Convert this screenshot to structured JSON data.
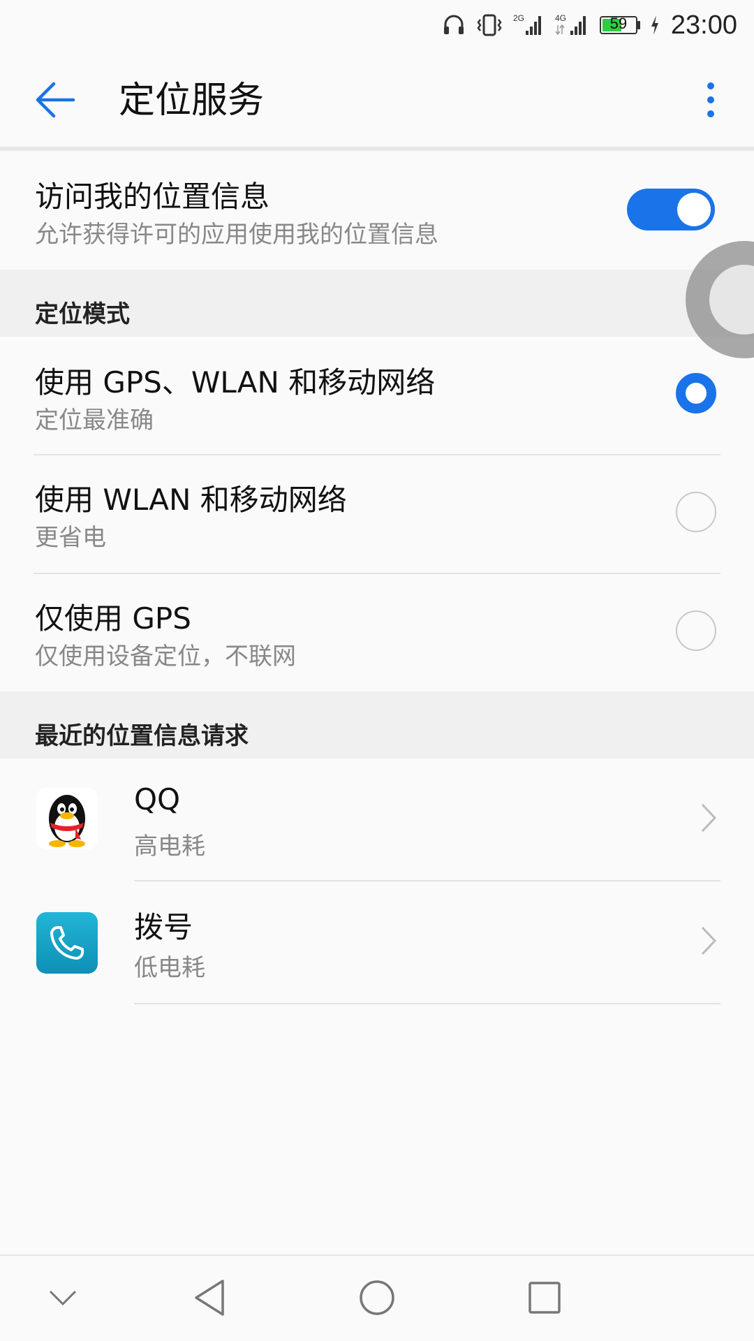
{
  "status_bar": {
    "time": "23:00",
    "battery_level": "59",
    "icons": [
      "headset-icon",
      "vibrate-icon",
      "signal-2g-icon",
      "signal-4g-icon",
      "battery-icon",
      "charging-icon"
    ],
    "network_1": "2G",
    "network_2": "4G"
  },
  "app_bar": {
    "title": "定位服务"
  },
  "location_access": {
    "title": "访问我的位置信息",
    "subtitle": "允许获得许可的应用使用我的位置信息",
    "enabled": true
  },
  "location_mode": {
    "header": "定位模式",
    "options": [
      {
        "title": "使用 GPS、WLAN 和移动网络",
        "subtitle": "定位最准确",
        "selected": true
      },
      {
        "title": "使用 WLAN 和移动网络",
        "subtitle": "更省电",
        "selected": false
      },
      {
        "title": "仅使用 GPS",
        "subtitle": "仅使用设备定位，不联网",
        "selected": false
      }
    ]
  },
  "recent_requests": {
    "header": "最近的位置信息请求",
    "apps": [
      {
        "name": "QQ",
        "usage": "高电耗",
        "icon": "qq-penguin-icon"
      },
      {
        "name": "拨号",
        "usage": "低电耗",
        "icon": "phone-icon"
      }
    ]
  },
  "colors": {
    "accent": "#1a73e8",
    "section_bg": "#f0f0f0",
    "subtitle": "#888888",
    "dialer": "#1aa3c9"
  },
  "nav_bar": {
    "icons": [
      "chevron-down-icon",
      "back-triangle-icon",
      "home-circle-icon",
      "recents-square-icon"
    ]
  }
}
